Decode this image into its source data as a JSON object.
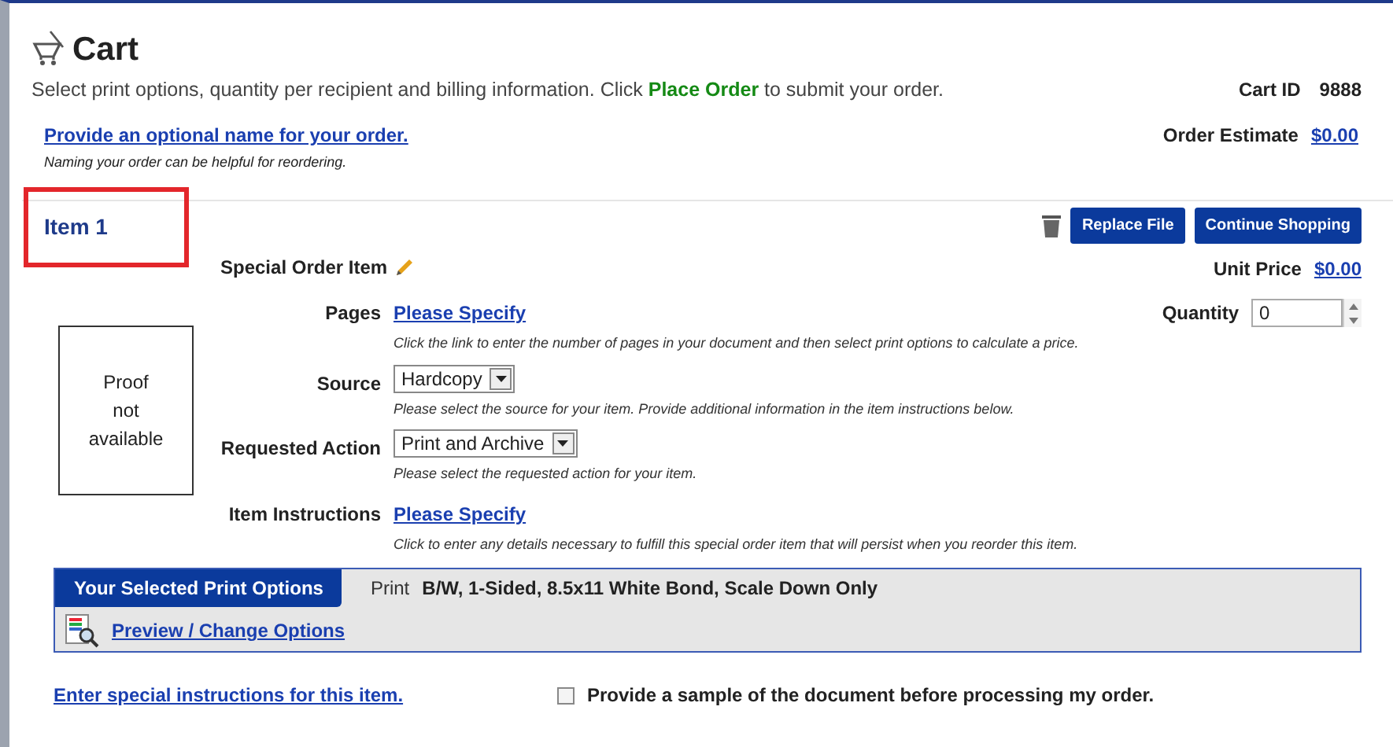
{
  "header": {
    "title": "Cart",
    "description": "Select print options, quantity per recipient and billing information. Click **Place Order** to submit your order.",
    "cart_id_label": "Cart ID",
    "cart_id": "9888",
    "name_link": "Provide an optional name for your order.",
    "name_hint": "Naming your order can be helpful for reordering.",
    "estimate_label": "Order Estimate",
    "estimate": "$0.00"
  },
  "item": {
    "title": "Item 1",
    "highlighted": true,
    "buttons": [
      "Replace File",
      "Continue Shopping"
    ],
    "name": "Special Order Item",
    "proof": "Proof not available",
    "unit_price_label": "Unit Price",
    "unit_price": "$0.00",
    "quantity_label": "Quantity",
    "quantity": "0",
    "fields": [
      {
        "kind": "link",
        "label": "Pages",
        "value": "Please Specify",
        "hint": "Click the link to enter the number of pages in your document and then select print options to calculate a price."
      },
      {
        "kind": "select",
        "label": "Source",
        "value": "Hardcopy",
        "hint": "Please select the source for your item. Provide additional information in the item instructions below."
      },
      {
        "kind": "select",
        "label": "Requested Action",
        "value": "Print and Archive",
        "hint": "Please select the requested action for your item."
      },
      {
        "kind": "link",
        "label": "Item Instructions",
        "value": "Please Specify",
        "hint": "Click to enter any details necessary to fulfill this special order item that will persist when you reorder this item."
      }
    ],
    "options": {
      "tab": "Your Selected Print Options",
      "print_label": "Print",
      "print_value": "B/W, 1-Sided, 8.5x11 White Bond, Scale Down Only",
      "preview_link": "Preview / Change Options"
    },
    "instructions_link": "Enter special instructions for this item.",
    "sample": {
      "label": "Provide a sample of the document before processing my order.",
      "checked": false
    }
  }
}
